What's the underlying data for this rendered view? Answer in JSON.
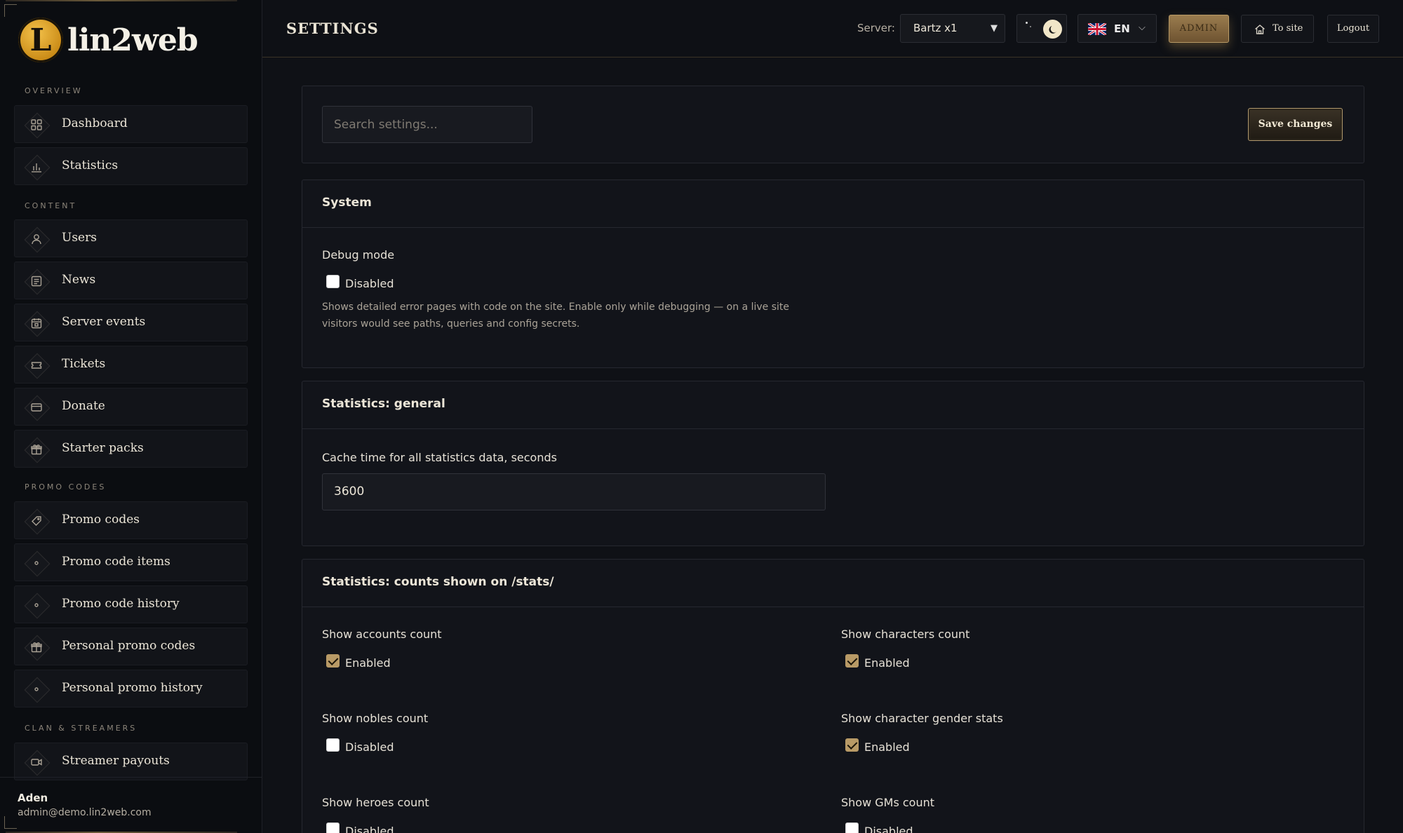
{
  "brand": {
    "logo_letter": "L",
    "name": "lin2web"
  },
  "sidebar": {
    "sections": {
      "overview": "Overview",
      "content": "Content",
      "promo": "Promo codes",
      "clan": "Clan & streamers"
    },
    "items": [
      {
        "label": "Dashboard",
        "icon": "grid-icon"
      },
      {
        "label": "Statistics",
        "icon": "bar-chart-icon"
      },
      {
        "label": "Users",
        "icon": "user-icon"
      },
      {
        "label": "News",
        "icon": "newspaper-icon"
      },
      {
        "label": "Server events",
        "icon": "calendar-icon"
      },
      {
        "label": "Tickets",
        "icon": "ticket-icon"
      },
      {
        "label": "Donate",
        "icon": "card-icon"
      },
      {
        "label": "Starter packs",
        "icon": "gift-icon"
      },
      {
        "label": "Promo codes",
        "icon": "tag-icon"
      },
      {
        "label": "Promo code items",
        "icon": "dot-icon"
      },
      {
        "label": "Promo code history",
        "icon": "dot-icon"
      },
      {
        "label": "Personal promo codes",
        "icon": "gift-icon"
      },
      {
        "label": "Personal promo history",
        "icon": "dot-icon"
      },
      {
        "label": "Streamer payouts",
        "icon": "video-icon"
      }
    ],
    "user": {
      "name": "Aden",
      "email": "admin@demo.lin2web.com"
    }
  },
  "topbar": {
    "title": "SETTINGS",
    "server_label": "Server:",
    "server_value": "Bartz x1",
    "lang_code": "EN",
    "admin_label": "ADMIN",
    "to_site_label": "To site",
    "logout_label": "Logout"
  },
  "toolbar": {
    "search_placeholder": "Search settings...",
    "save_label": "Save changes"
  },
  "system": {
    "title": "System",
    "debug_label": "Debug mode",
    "debug_value": "Disabled",
    "debug_hint": "Shows detailed error pages with code on the site. Enable only while debugging — on a live site visitors would see paths, queries and config secrets."
  },
  "stats_general": {
    "title": "Statistics: general",
    "cache_label": "Cache time for all statistics data, seconds",
    "cache_value": "3600"
  },
  "stats_counts": {
    "title": "Statistics: counts shown on /stats/",
    "fields": [
      {
        "label": "Show accounts count",
        "value": "Enabled",
        "checked": true
      },
      {
        "label": "Show characters count",
        "value": "Enabled",
        "checked": true
      },
      {
        "label": "Show nobles count",
        "value": "Disabled",
        "checked": false
      },
      {
        "label": "Show character gender stats",
        "value": "Enabled",
        "checked": true
      },
      {
        "label": "Show heroes count",
        "value": "Disabled",
        "checked": false
      },
      {
        "label": "Show GMs count",
        "value": "Disabled",
        "checked": false
      }
    ]
  },
  "colors": {
    "accent": "#b89a66",
    "background": "#0f1116",
    "panel": "#12141a"
  }
}
